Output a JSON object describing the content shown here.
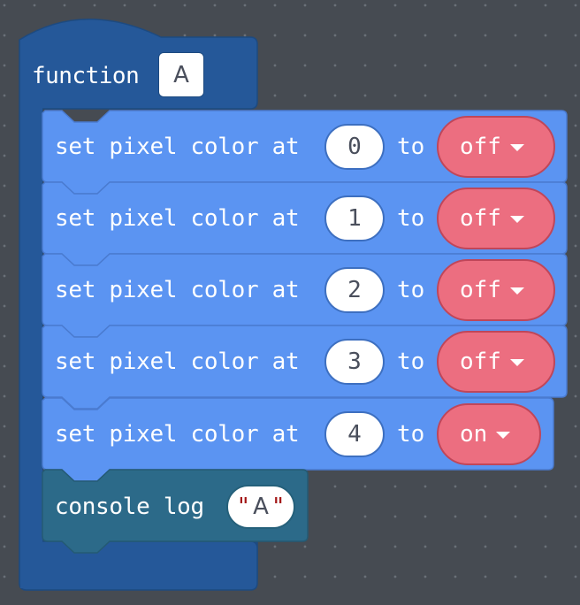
{
  "colors": {
    "workspace_bg": "#464b52",
    "function_block": "#255899",
    "pixel_block": "#5b94f2",
    "console_block": "#2c6a89",
    "dropdown": "#ec6e80"
  },
  "function_block": {
    "keyword": "function",
    "name": "A"
  },
  "statements": [
    {
      "text": "set pixel color at",
      "index": "0",
      "to_label": "to",
      "state": "off",
      "icon": "caret-down-icon"
    },
    {
      "text": "set pixel color at",
      "index": "1",
      "to_label": "to",
      "state": "off",
      "icon": "caret-down-icon"
    },
    {
      "text": "set pixel color at",
      "index": "2",
      "to_label": "to",
      "state": "off",
      "icon": "caret-down-icon"
    },
    {
      "text": "set pixel color at",
      "index": "3",
      "to_label": "to",
      "state": "off",
      "icon": "caret-down-icon"
    },
    {
      "text": "set pixel color at",
      "index": "4",
      "to_label": "to",
      "state": "on",
      "icon": "caret-down-icon"
    }
  ],
  "console_block": {
    "text": "console log",
    "quote_open": "\"",
    "value": "A",
    "quote_close": "\""
  }
}
